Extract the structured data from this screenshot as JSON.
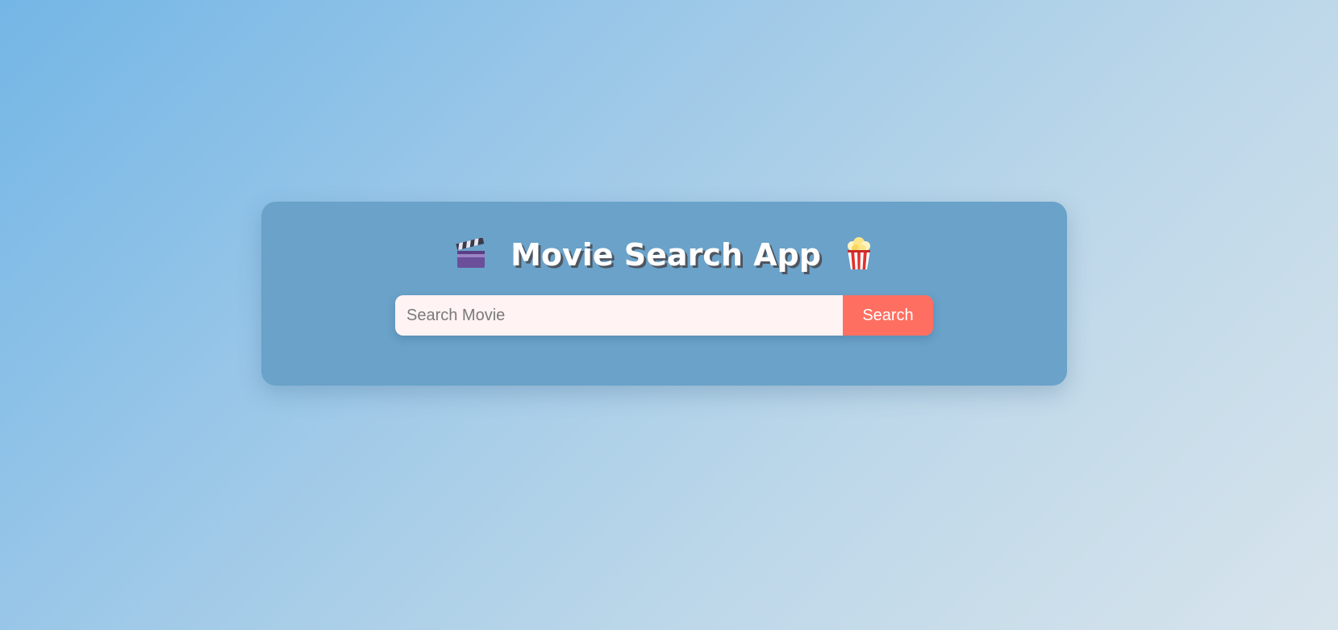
{
  "app": {
    "title": "Movie Search App",
    "title_left_icon": "clapper-board-icon",
    "title_right_icon": "popcorn-icon"
  },
  "search": {
    "placeholder": "Search Movie",
    "value": "",
    "button_label": "Search"
  },
  "colors": {
    "card_background": "#6aa2c9",
    "input_background": "#fff3f3",
    "button_background": "#ff6f61",
    "title_text": "#ffffff"
  }
}
